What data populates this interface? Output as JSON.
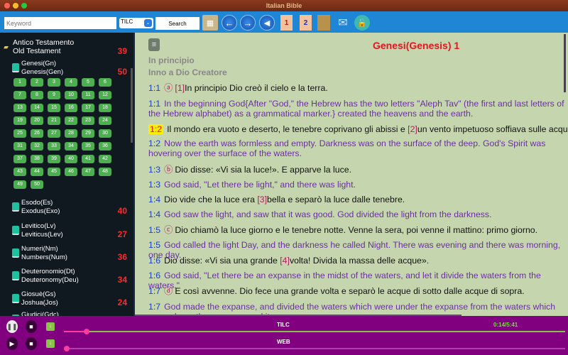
{
  "window": {
    "title": "Italian Bible"
  },
  "toolbar": {
    "keyword_placeholder": "Keyword",
    "version": "TILC",
    "search_label": "Search",
    "icons": [
      "book-grid-icon",
      "arrow-left-icon",
      "arrow-right-icon",
      "speaker-icon",
      "bookmark-1-icon",
      "bookmark-2-icon",
      "picture-icon",
      "mail-icon",
      "lock-icon"
    ],
    "bookmark1": "1",
    "bookmark2": "2"
  },
  "sidebar": {
    "group": {
      "name_it": "Antico Testamento",
      "name_en": "Old Testament",
      "count": "39"
    },
    "books": [
      {
        "it": "Genesi(Gn)",
        "en": "Genesis(Gen)",
        "count": "50"
      },
      {
        "it": "Esodo(Es)",
        "en": "Exodus(Exo)",
        "count": "40"
      },
      {
        "it": "Levitico(Lv)",
        "en": "Leviticus(Lev)",
        "count": "27"
      },
      {
        "it": "Numeri(Nm)",
        "en": "Numbers(Num)",
        "count": "36"
      },
      {
        "it": "Deuteronomio(Dt)",
        "en": "Deuteronomy(Deu)",
        "count": "34"
      },
      {
        "it": "Giosuè(Gs)",
        "en": "Joshua(Jos)",
        "count": "24"
      },
      {
        "it": "Giudici(Gdc)",
        "en": "",
        "count": ""
      }
    ],
    "chapter_count": 50
  },
  "content": {
    "title": "Genesi(Genesis) 1",
    "subtitle1": "In principio",
    "subtitle2": "Inno a Dio Creatore",
    "verses": [
      {
        "ref": "1:1",
        "lang": "it",
        "circle": "ⓐ",
        "pre": "",
        "note": "[1]",
        "post": "In principio Dio creò il cielo e la terra."
      },
      {
        "ref": "1:1",
        "lang": "en",
        "pre": "In the beginning God{After \"God,\" the Hebrew has the two letters \"Aleph Tav\" (the first and last letters of the Hebrew alphabet) as a grammatical marker.} created the heavens and the earth."
      },
      {
        "ref": "1:2",
        "lang": "it",
        "highlight": true,
        "pre": "Il mondo era vuoto e deserto, le tenebre coprivano gli abissi e ",
        "note": "[2]",
        "post": "un vento impetuoso soffiava sulle acque."
      },
      {
        "ref": "1:2",
        "lang": "en",
        "pre": "Now the earth was formless and empty. Darkness was on the surface of the deep. God's Spirit was hovering over the surface of the waters."
      },
      {
        "ref": "1:3",
        "lang": "it",
        "circle": "ⓑ",
        "pre": "Dio disse: «Vi sia la luce!». E apparve la luce."
      },
      {
        "ref": "1:3",
        "lang": "en",
        "pre": "God said, \"Let there be light,\" and there was light."
      },
      {
        "ref": "1:4",
        "lang": "it",
        "pre": "Dio vide che la luce era ",
        "note": "[3]",
        "post": "bella e separò la luce dalle tenebre."
      },
      {
        "ref": "1:4",
        "lang": "en",
        "pre": "God saw the light, and saw that it was good. God divided the light from the darkness."
      },
      {
        "ref": "1:5",
        "lang": "it",
        "circle": "ⓒ",
        "pre": "Dio chiamò la luce giorno e le tenebre notte. Venne la sera, poi venne il mattino: primo giorno."
      },
      {
        "ref": "1:5",
        "lang": "en",
        "pre": "God called the light Day, and the darkness he called Night. There was evening and there was morning, one day."
      },
      {
        "ref": "1:6",
        "lang": "it",
        "pre": "Dio disse: «Vi sia una grande ",
        "note": "[4]",
        "post": "volta! Divida la massa delle acque»."
      },
      {
        "ref": "1:6",
        "lang": "en",
        "pre": "God said, \"Let there be an expanse in the midst of the waters, and let it divide the waters from the waters.\""
      },
      {
        "ref": "1:7",
        "lang": "it",
        "circle": "ⓓ",
        "pre": "E così avvenne. Dio fece una grande volta e separò le acque di sotto dalle acque di sopra."
      },
      {
        "ref": "1:7",
        "lang": "en",
        "pre": "God made the expanse, and divided the waters which were under the expanse from the waters which were above the expanse; and it was so."
      }
    ]
  },
  "player": {
    "tracks": [
      {
        "name": "TILC",
        "progress": 0.04,
        "time": "0:14/5:41"
      },
      {
        "name": "WEB",
        "progress": 0
      }
    ]
  },
  "colors": {
    "toolbar": "#1f86d6",
    "player": "#800080",
    "chapter_button": "#4caf50",
    "count": "#ff2a2a",
    "title": "#e8141e"
  }
}
